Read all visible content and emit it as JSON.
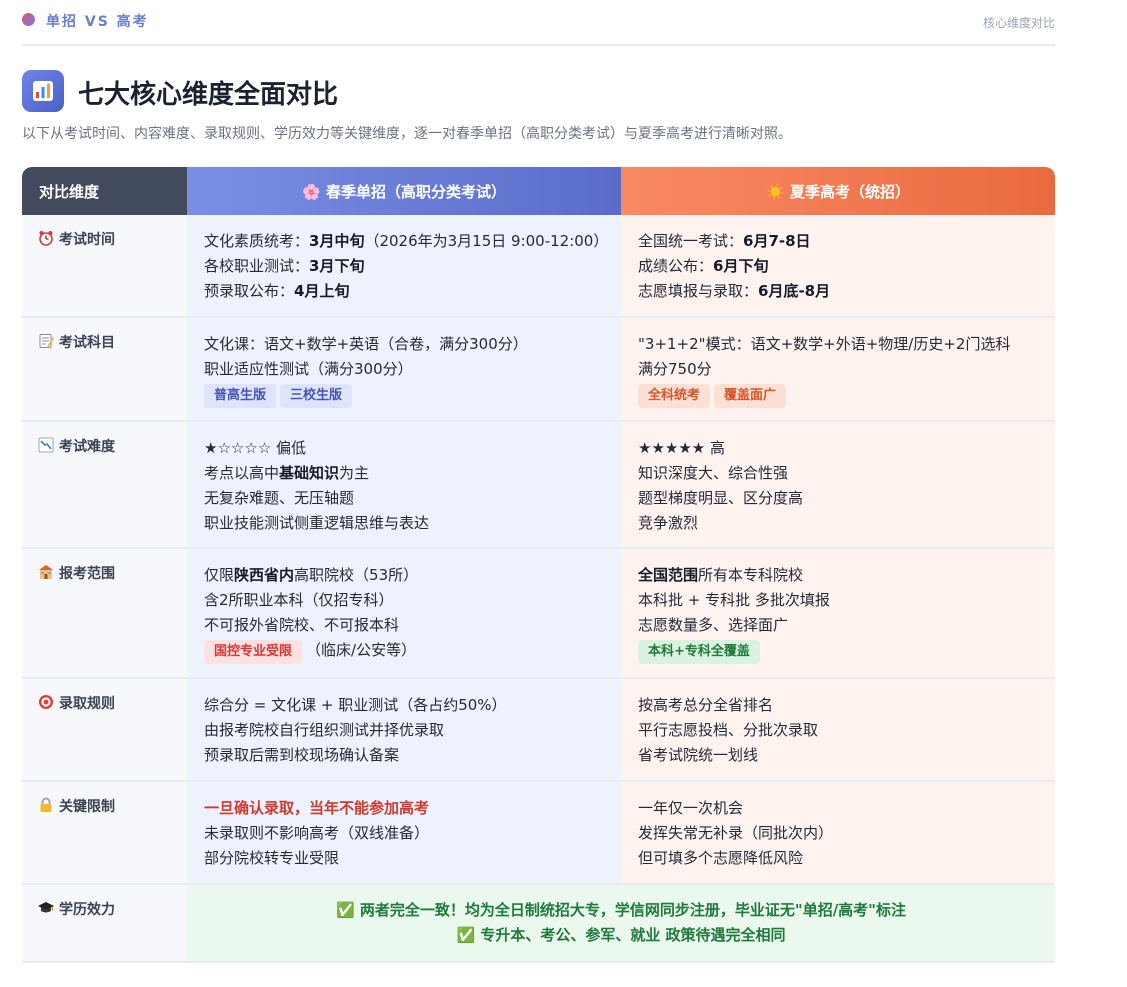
{
  "header": {
    "brand": "单招 VS 高考",
    "right_label": "核心维度对比"
  },
  "title": "七大核心维度全面对比",
  "subtitle": "以下从考试时间、内容难度、录取规则、学历效力等关键维度，逐一对春季单招（高职分类考试）与夏季高考进行清晰对照。",
  "table": {
    "col_dim": "对比维度",
    "col_spring": "🌸 春季单招（高职分类考试）",
    "col_summer": "☀️ 夏季高考（统招）",
    "rows": [
      {
        "dim": "考试时间",
        "icon": "alarm-clock-icon",
        "spring": [
          [
            {
              "t": "文化素质统考："
            },
            {
              "t": "3月中旬",
              "b": true
            },
            {
              "t": "（2026年为3月15日 9:00-12:00）"
            }
          ],
          [
            {
              "t": "各校职业测试："
            },
            {
              "t": "3月下旬",
              "b": true
            }
          ],
          [
            {
              "t": "预录取公布："
            },
            {
              "t": "4月上旬",
              "b": true
            }
          ]
        ],
        "summer": [
          [
            {
              "t": "全国统一考试："
            },
            {
              "t": "6月7-8日",
              "b": true
            }
          ],
          [
            {
              "t": "成绩公布："
            },
            {
              "t": "6月下旬",
              "b": true
            }
          ],
          [
            {
              "t": "志愿填报与录取："
            },
            {
              "t": "6月底-8月",
              "b": true
            }
          ]
        ]
      },
      {
        "dim": "考试科目",
        "icon": "memo-icon",
        "spring": [
          [
            {
              "t": "文化课：语文+数学+英语（合卷，满分300分）"
            }
          ],
          [
            {
              "t": "职业适应性测试（满分300分）"
            }
          ]
        ],
        "spring_tags": [
          "普高生版",
          "三校生版"
        ],
        "summer": [
          [
            {
              "t": "\"3+1+2\"模式：语文+数学+外语+物理/历史+2门选科"
            }
          ],
          [
            {
              "t": "满分750分"
            }
          ]
        ],
        "summer_tags": [
          "全科统考",
          "覆盖面广"
        ]
      },
      {
        "dim": "考试难度",
        "icon": "chart-down-icon",
        "spring": [
          [
            {
              "t": "★☆☆☆☆ 偏低"
            }
          ],
          [
            {
              "t": "考点以高中"
            },
            {
              "t": "基础知识",
              "b": true
            },
            {
              "t": "为主"
            }
          ],
          [
            {
              "t": "无复杂难题、无压轴题"
            }
          ],
          [
            {
              "t": "职业技能测试侧重逻辑思维与表达"
            }
          ]
        ],
        "summer": [
          [
            {
              "t": "★★★★★ 高"
            }
          ],
          [
            {
              "t": "知识深度大、综合性强"
            }
          ],
          [
            {
              "t": "题型梯度明显、区分度高"
            }
          ],
          [
            {
              "t": "竞争激烈"
            }
          ]
        ]
      },
      {
        "dim": "报考范围",
        "icon": "school-icon",
        "spring": [
          [
            {
              "t": "仅限"
            },
            {
              "t": "陕西省内",
              "b": true
            },
            {
              "t": "高职院校（53所）"
            }
          ],
          [
            {
              "t": "含2所职业本科（仅招专科）"
            }
          ],
          [
            {
              "t": "不可报外省院校、不可报本科"
            }
          ]
        ],
        "spring_tag_line": {
          "tag": "国控专业受限",
          "text": "（临床/公安等）"
        },
        "summer": [
          [
            {
              "t": "全国范围",
              "b": true
            },
            {
              "t": "所有本专科院校"
            }
          ],
          [
            {
              "t": "本科批 + 专科批 多批次填报"
            }
          ],
          [
            {
              "t": "志愿数量多、选择面广"
            }
          ]
        ],
        "summer_tags": [
          "本科+专科全覆盖"
        ]
      },
      {
        "dim": "录取规则",
        "icon": "target-icon",
        "spring": [
          [
            {
              "t": "综合分 = 文化课 + 职业测试（各占约50%）"
            }
          ],
          [
            {
              "t": "由报考院校自行组织测试并择优录取"
            }
          ],
          [
            {
              "t": "预录取后需到校现场确认备案"
            }
          ]
        ],
        "summer": [
          [
            {
              "t": "按高考总分全省排名"
            }
          ],
          [
            {
              "t": "平行志愿投档、分批次录取"
            }
          ],
          [
            {
              "t": "省考试院统一划线"
            }
          ]
        ]
      },
      {
        "dim": "关键限制",
        "icon": "lock-icon",
        "spring": [
          [
            {
              "t": "一旦确认录取，当年不能参加高考",
              "r": true
            }
          ],
          [
            {
              "t": "未录取则不影响高考（双线准备）"
            }
          ],
          [
            {
              "t": "部分院校转专业受限"
            }
          ]
        ],
        "summer": [
          [
            {
              "t": "一年仅一次机会"
            }
          ],
          [
            {
              "t": "发挥失常无补录（同批次内）"
            }
          ],
          [
            {
              "t": "但可填多个志愿降低风险"
            }
          ]
        ]
      }
    ],
    "final_row": {
      "dim": "学历效力",
      "icon": "graduation-cap-icon",
      "line1": "✅ 两者完全一致！均为全日制统招大专，学信网同步注册，毕业证无\"单招/高考\"标注",
      "line2": "✅ 专升本、考公、参军、就业 政策待遇完全相同"
    }
  },
  "colors": {
    "spring_header": "#6a7fdc",
    "summer_header": "#f07a4f",
    "dim_header": "#414b5d",
    "spring_bg": "#eef2fd",
    "summer_bg": "#fff3ef",
    "merged_bg": "#eaf8ee"
  }
}
